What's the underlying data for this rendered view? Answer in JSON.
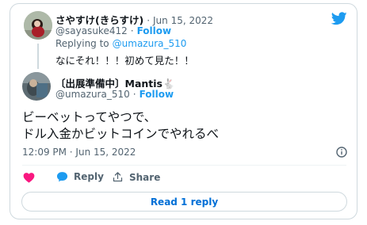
{
  "first_tweet": {
    "display_name": "さやすけ(きらすけ)",
    "timestamp_sep": "·",
    "date": "Jun 15, 2022",
    "handle": "@sayasuke412",
    "follow_sep": "·",
    "follow_label": "Follow",
    "replying_prefix": "Replying to",
    "replying_to": "@umazura_510",
    "text": "なにそれ！！！初めて見た！！"
  },
  "main_tweet": {
    "display_name": "〔出展準備中〕Mantis🐇",
    "handle": "@umazura_510",
    "follow_sep": "·",
    "follow_label": "Follow",
    "text_line1": "ビーベットってやつで、",
    "text_line2": "ドル入金かビットコインでやれるべ",
    "time": "12:09 PM · Jun 15, 2022"
  },
  "actions": {
    "reply_label": "Reply",
    "share_label": "Share"
  },
  "read_replies_label": "Read 1 reply",
  "icons": [
    "twitter-bird-icon",
    "info-icon",
    "heart-icon",
    "reply-bubble-icon",
    "share-icon"
  ],
  "colors": {
    "accent": "#1d9bf0",
    "like": "#f91880",
    "text": "#0f1419",
    "secondary": "#536471",
    "border": "#cfd9de"
  }
}
